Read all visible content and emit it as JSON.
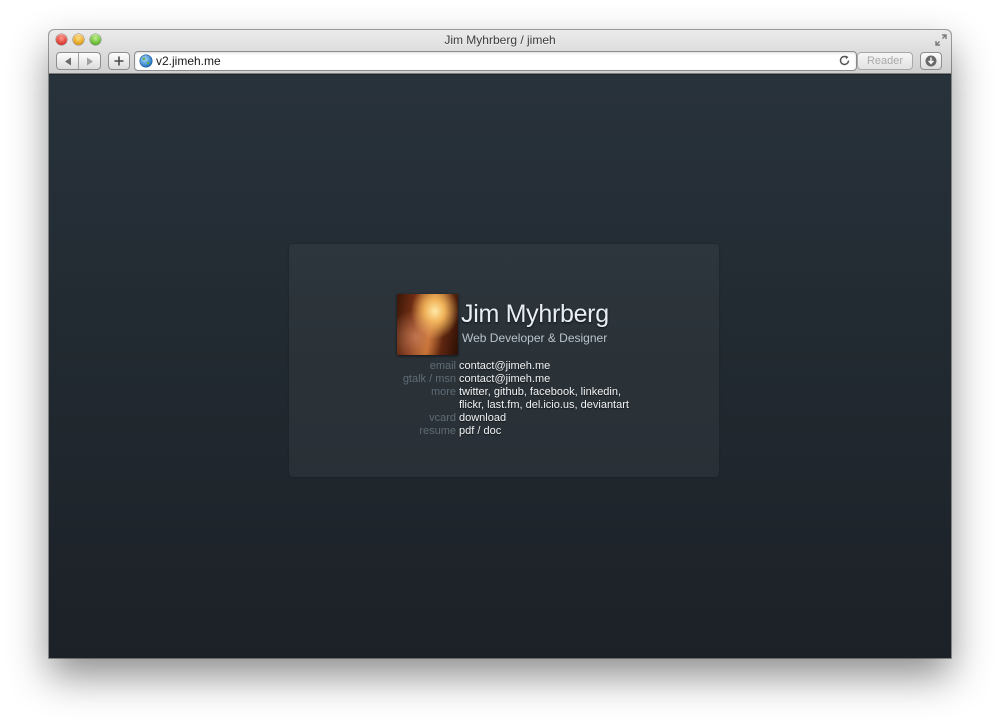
{
  "window": {
    "title": "Jim Myhrberg / jimeh",
    "url": "v2.jimeh.me",
    "reader_label": "Reader"
  },
  "profile": {
    "name": "Jim Myhrberg",
    "tagline": "Web Developer & Designer"
  },
  "contact": {
    "email_label": "email",
    "email_value": "contact@jimeh.me",
    "gtalk_label": "gtalk / msn",
    "gtalk_value": "contact@jimeh.me",
    "more_label": "more",
    "more_line1": "twitter, github, facebook, linkedin,",
    "more_line2": "flickr, last.fm, del.icio.us, deviantart",
    "vcard_label": "vcard",
    "vcard_value": "download",
    "resume_label": "resume",
    "resume_value": "pdf / doc"
  }
}
